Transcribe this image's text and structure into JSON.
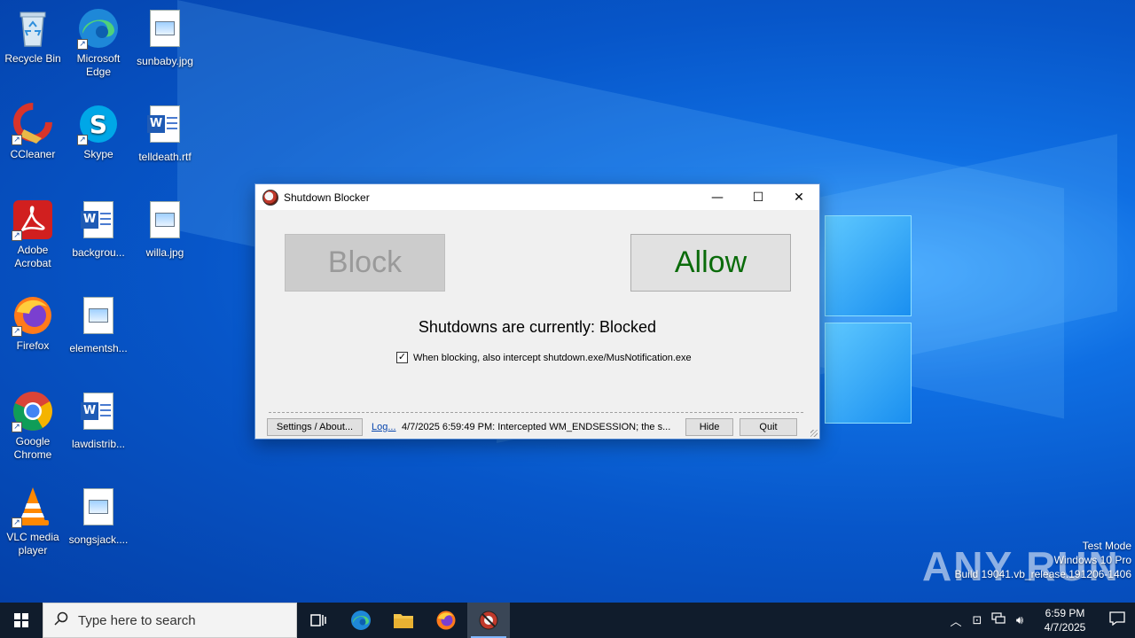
{
  "desktop": {
    "icons": [
      {
        "label": "Recycle Bin"
      },
      {
        "label": "Microsoft Edge"
      },
      {
        "label": "sunbaby.jpg"
      },
      {
        "label": "CCleaner"
      },
      {
        "label": "Skype"
      },
      {
        "label": "telldeath.rtf"
      },
      {
        "label": "Adobe Acrobat"
      },
      {
        "label": "backgrou..."
      },
      {
        "label": "willa.jpg"
      },
      {
        "label": "Firefox"
      },
      {
        "label": "elementsh..."
      },
      {
        "label": "Google Chrome"
      },
      {
        "label": "lawdistrib..."
      },
      {
        "label": "VLC media player"
      },
      {
        "label": "songsjack...."
      }
    ]
  },
  "window": {
    "title": "Shutdown Blocker",
    "minimize_glyph": "—",
    "maximize_glyph": "☐",
    "close_glyph": "✕",
    "block_label": "Block",
    "allow_label": "Allow",
    "status_text": "Shutdowns are currently: Blocked",
    "checkbox_label": "When blocking, also intercept shutdown.exe/MusNotification.exe",
    "checkbox_checked": true,
    "settings_label": "Settings / About...",
    "log_link": "Log...",
    "log_text": "4/7/2025 6:59:49 PM: Intercepted WM_ENDSESSION; the s...",
    "hide_label": "Hide",
    "quit_label": "Quit"
  },
  "watermark": {
    "brand": "ANY RUN",
    "line1": "Test Mode",
    "line2": "Windows 10 Pro",
    "line3": "Build 19041.vb_release.191206-1406"
  },
  "taskbar": {
    "search_placeholder": "Type here to search",
    "time": "6:59 PM",
    "date": "4/7/2025"
  },
  "colors": {
    "allow_text": "#0a6b0a",
    "block_text": "#9a9a9a",
    "taskbar": "#101c2c"
  }
}
